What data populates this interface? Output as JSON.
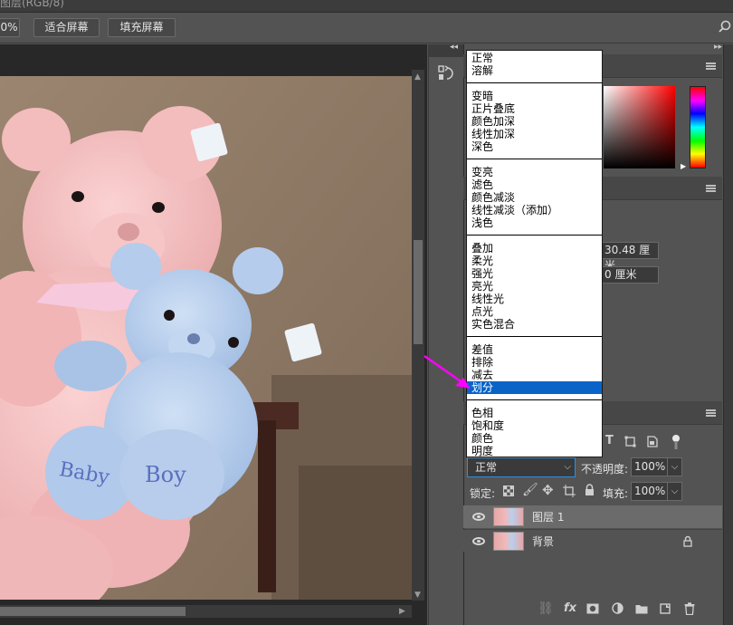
{
  "title_strip": "图层(RGB/8)",
  "options_bar": {
    "zoom_fragment": "0%",
    "fit_screen": "适合屏幕",
    "fill_screen": "填充屏幕"
  },
  "properties": {
    "width_value": "30.48 厘米",
    "offset_value": "0 厘米"
  },
  "layers_panel": {
    "blend_mode": "正常",
    "opacity_label": "不透明度:",
    "opacity_value": "100%",
    "lock_label": "锁定:",
    "fill_label": "填充:",
    "fill_value": "100%",
    "layers": [
      {
        "name": "图层 1",
        "selected": true,
        "locked": false
      },
      {
        "name": "背景",
        "selected": false,
        "locked": true
      }
    ]
  },
  "blend_dropdown": {
    "selected": "划分",
    "groups": [
      [
        "正常",
        "溶解"
      ],
      [
        "变暗",
        "正片叠底",
        "颜色加深",
        "线性加深",
        "深色"
      ],
      [
        "变亮",
        "滤色",
        "颜色减淡",
        "线性减淡（添加）",
        "浅色"
      ],
      [
        "叠加",
        "柔光",
        "强光",
        "亮光",
        "线性光",
        "点光",
        "实色混合"
      ],
      [
        "差值",
        "排除",
        "减去",
        "划分"
      ],
      [
        "色相",
        "饱和度",
        "颜色",
        "明度"
      ]
    ]
  },
  "colors": {
    "selection_blue": "#0a64c8",
    "annotation_magenta": "#ff00ff",
    "panel_bg": "#535353",
    "canvas_bg": "#282828"
  },
  "icons": [
    "search-icon",
    "history-icon",
    "panel-menu-icon",
    "eye-icon",
    "lock-icon",
    "link-icon",
    "fx-icon",
    "mask-icon",
    "adjustment-icon",
    "folder-icon",
    "new-layer-icon",
    "trash-icon",
    "type-filter-icon",
    "shape-filter-icon",
    "smart-filter-icon",
    "pixel-lock-icon",
    "paint-lock-icon",
    "move-lock-icon",
    "artboard-lock-icon"
  ]
}
